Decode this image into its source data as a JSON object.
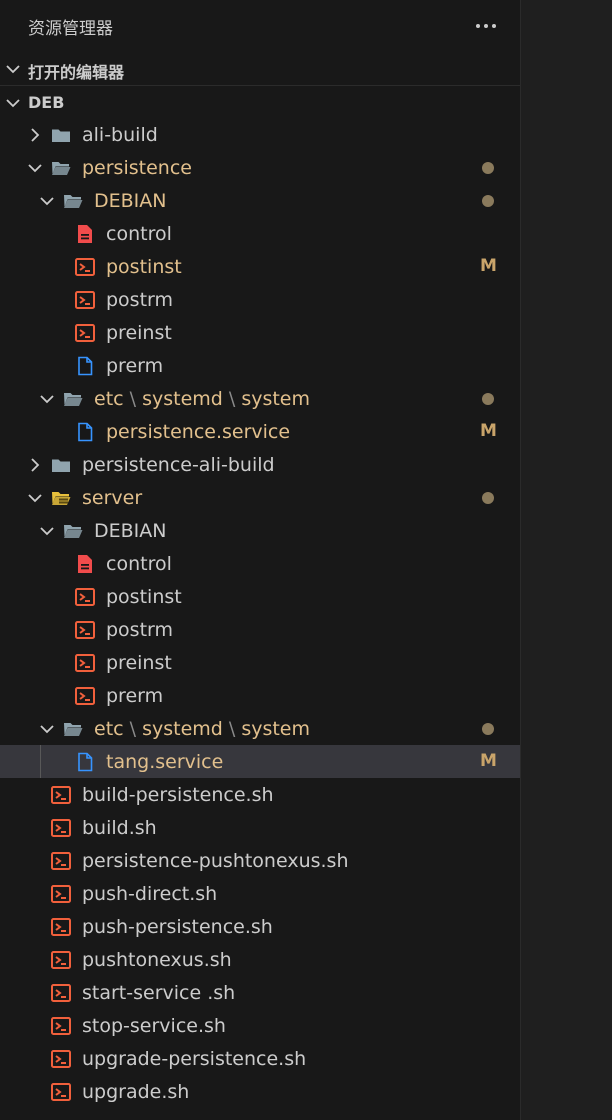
{
  "panel": {
    "title": "资源管理器",
    "more_icon": "ellipsis-icon",
    "sections": {
      "open_editors": "打开的编辑器",
      "root": "DEB"
    }
  },
  "colors": {
    "modified_text": "#e2c08d",
    "normal_text": "#cccccc",
    "shell_icon": "#f1603c",
    "control_icon": "#f14c4c",
    "generic_file_icon": "#3794ff",
    "folder_icon": "#90a4ae",
    "special_folder_icon": "#e8c03c"
  },
  "tree": [
    {
      "name": "ali-build",
      "kind": "folder",
      "expanded": false,
      "depth": 0,
      "modified": false,
      "icon": "folder-icon"
    },
    {
      "name": "persistence",
      "kind": "folder",
      "expanded": true,
      "depth": 0,
      "modified": true,
      "icon": "folder-open-icon",
      "status": "dot"
    },
    {
      "name": "DEBIAN",
      "kind": "folder",
      "expanded": true,
      "depth": 1,
      "modified": true,
      "icon": "folder-open-icon",
      "status": "dot"
    },
    {
      "name": "control",
      "kind": "file",
      "depth": 2,
      "modified": false,
      "icon": "control-file-icon"
    },
    {
      "name": "postinst",
      "kind": "file",
      "depth": 2,
      "modified": true,
      "icon": "shell-script-icon",
      "status": "M"
    },
    {
      "name": "postrm",
      "kind": "file",
      "depth": 2,
      "modified": false,
      "icon": "shell-script-icon"
    },
    {
      "name": "preinst",
      "kind": "file",
      "depth": 2,
      "modified": false,
      "icon": "shell-script-icon"
    },
    {
      "name": "prerm",
      "kind": "file",
      "depth": 2,
      "modified": false,
      "icon": "file-icon"
    },
    {
      "name": "etc",
      "path": [
        "etc",
        "systemd",
        "system"
      ],
      "kind": "folder",
      "expanded": true,
      "depth": 1,
      "modified": true,
      "icon": "folder-open-icon",
      "status": "dot"
    },
    {
      "name": "persistence.service",
      "kind": "file",
      "depth": 2,
      "modified": true,
      "icon": "file-icon",
      "status": "M"
    },
    {
      "name": "persistence-ali-build",
      "kind": "folder",
      "expanded": false,
      "depth": 0,
      "modified": false,
      "icon": "folder-icon"
    },
    {
      "name": "server",
      "kind": "folder",
      "expanded": true,
      "depth": 0,
      "modified": true,
      "icon": "server-folder-open-icon",
      "status": "dot"
    },
    {
      "name": "DEBIAN",
      "kind": "folder",
      "expanded": true,
      "depth": 1,
      "modified": false,
      "icon": "folder-open-icon"
    },
    {
      "name": "control",
      "kind": "file",
      "depth": 2,
      "modified": false,
      "icon": "control-file-icon"
    },
    {
      "name": "postinst",
      "kind": "file",
      "depth": 2,
      "modified": false,
      "icon": "shell-script-icon"
    },
    {
      "name": "postrm",
      "kind": "file",
      "depth": 2,
      "modified": false,
      "icon": "shell-script-icon"
    },
    {
      "name": "preinst",
      "kind": "file",
      "depth": 2,
      "modified": false,
      "icon": "shell-script-icon"
    },
    {
      "name": "prerm",
      "kind": "file",
      "depth": 2,
      "modified": false,
      "icon": "shell-script-icon"
    },
    {
      "name": "etc",
      "path": [
        "etc",
        "systemd",
        "system"
      ],
      "kind": "folder",
      "expanded": true,
      "depth": 1,
      "modified": true,
      "icon": "folder-open-icon",
      "status": "dot"
    },
    {
      "name": "tang.service",
      "kind": "file",
      "depth": 2,
      "modified": true,
      "icon": "file-icon",
      "status": "M",
      "selected": true
    },
    {
      "name": "build-persistence.sh",
      "kind": "file",
      "depth": 0,
      "modified": false,
      "icon": "shell-script-icon"
    },
    {
      "name": "build.sh",
      "kind": "file",
      "depth": 0,
      "modified": false,
      "icon": "shell-script-icon"
    },
    {
      "name": "persistence-pushtonexus.sh",
      "kind": "file",
      "depth": 0,
      "modified": false,
      "icon": "shell-script-icon"
    },
    {
      "name": "push-direct.sh",
      "kind": "file",
      "depth": 0,
      "modified": false,
      "icon": "shell-script-icon"
    },
    {
      "name": "push-persistence.sh",
      "kind": "file",
      "depth": 0,
      "modified": false,
      "icon": "shell-script-icon"
    },
    {
      "name": "pushtonexus.sh",
      "kind": "file",
      "depth": 0,
      "modified": false,
      "icon": "shell-script-icon"
    },
    {
      "name": "start-service .sh",
      "kind": "file",
      "depth": 0,
      "modified": false,
      "icon": "shell-script-icon"
    },
    {
      "name": "stop-service.sh",
      "kind": "file",
      "depth": 0,
      "modified": false,
      "icon": "shell-script-icon"
    },
    {
      "name": "upgrade-persistence.sh",
      "kind": "file",
      "depth": 0,
      "modified": false,
      "icon": "shell-script-icon"
    },
    {
      "name": "upgrade.sh",
      "kind": "file",
      "depth": 0,
      "modified": false,
      "icon": "shell-script-icon"
    }
  ]
}
